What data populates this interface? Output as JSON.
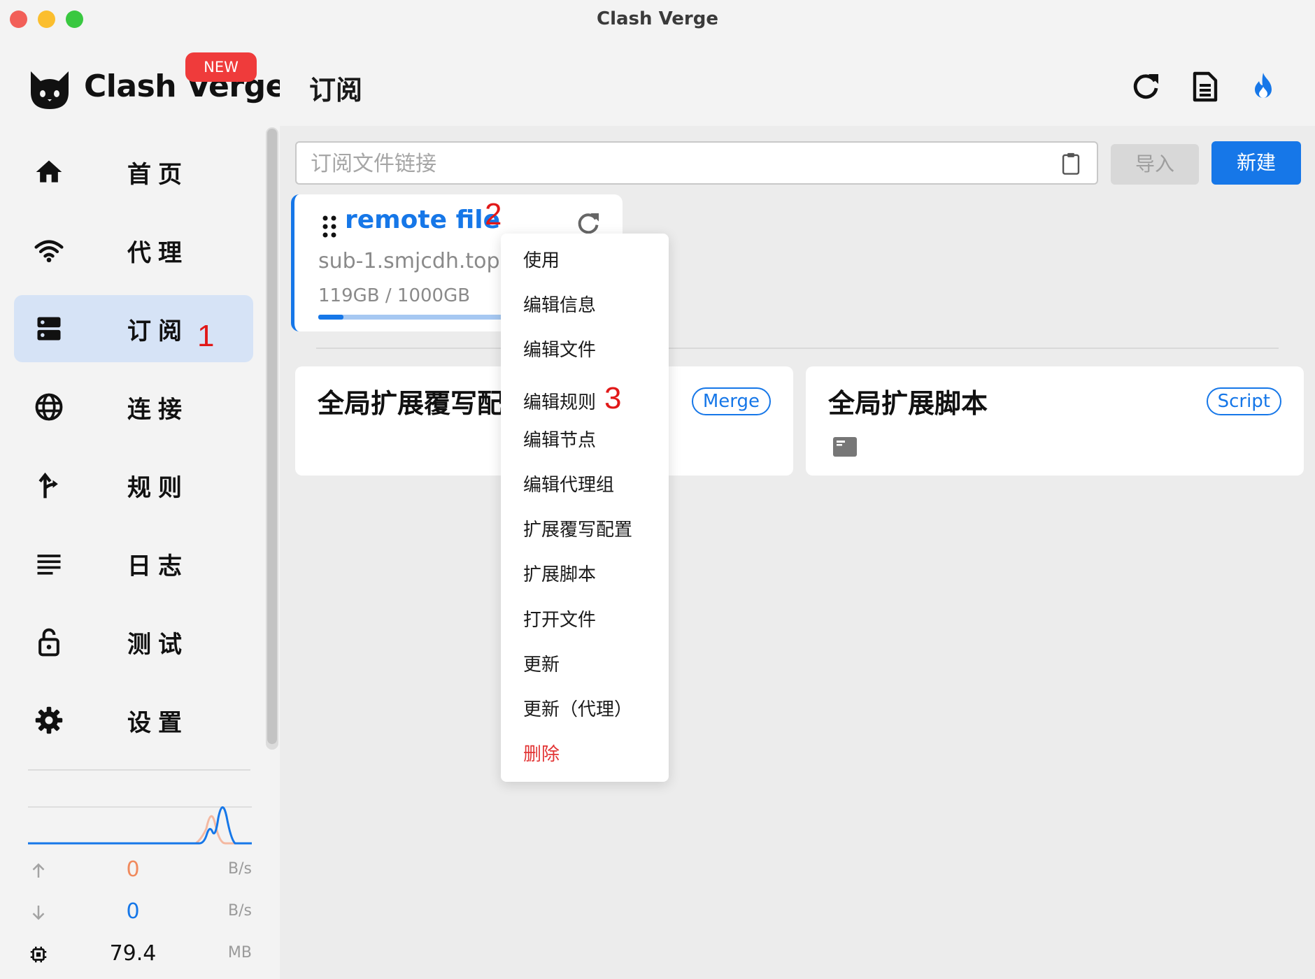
{
  "window": {
    "title": "Clash Verge",
    "traffic_lights": [
      "#f25f58",
      "#fbbe2e",
      "#39c840"
    ]
  },
  "sidebar": {
    "logo_text": "Clash Verge",
    "badge": "NEW",
    "items": [
      {
        "label": "首页",
        "icon": "home-icon"
      },
      {
        "label": "代理",
        "icon": "wifi-icon"
      },
      {
        "label": "订阅",
        "icon": "storage-icon",
        "active": true,
        "step": "1"
      },
      {
        "label": "连接",
        "icon": "globe-icon"
      },
      {
        "label": "规则",
        "icon": "fork-icon"
      },
      {
        "label": "日志",
        "icon": "lines-icon"
      },
      {
        "label": "测试",
        "icon": "lock-icon"
      },
      {
        "label": "设置",
        "icon": "gear-icon"
      }
    ],
    "stats": {
      "upload": {
        "value": "0",
        "unit": "B/s",
        "color": "#f08a5d"
      },
      "download": {
        "value": "0",
        "unit": "B/s",
        "color": "#1677e8"
      },
      "memory": {
        "value": "79.4",
        "unit": "MB"
      }
    }
  },
  "main": {
    "title": "订阅",
    "search_placeholder": "订阅文件链接",
    "import_label": "导入",
    "new_label": "新建",
    "profile": {
      "title": "remote file",
      "step": "2",
      "url": "sub-1.smjcdh.top",
      "usage": "119GB / 1000GB",
      "usage_fraction": 0.119
    },
    "ext_cards": [
      {
        "title": "全局扩展覆写配置",
        "chip": "Merge"
      },
      {
        "title": "全局扩展脚本",
        "chip": "Script"
      }
    ]
  },
  "context_menu": {
    "items": [
      {
        "label": "使用"
      },
      {
        "label": "编辑信息"
      },
      {
        "label": "编辑文件"
      },
      {
        "label": "编辑规则",
        "step": "3"
      },
      {
        "label": "编辑节点"
      },
      {
        "label": "编辑代理组"
      },
      {
        "label": "扩展覆写配置"
      },
      {
        "label": "扩展脚本"
      },
      {
        "label": "打开文件"
      },
      {
        "label": "更新"
      },
      {
        "label": "更新（代理）"
      },
      {
        "label": "删除",
        "danger": true
      }
    ]
  },
  "colors": {
    "accent": "#1677e8",
    "danger": "#e23434",
    "badge": "#ef3b3b",
    "step_marker": "#e11818"
  }
}
